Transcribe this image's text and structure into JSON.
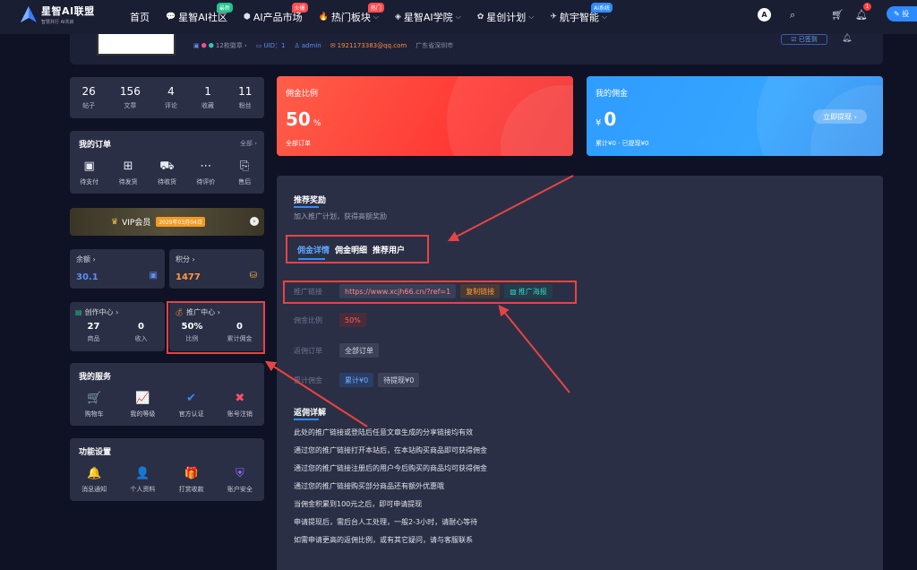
{
  "nav": {
    "logo_title": "星智AI联盟",
    "logo_sub": "智慧共行 AI共启",
    "items": [
      {
        "label": "首页",
        "icon": "",
        "badge": "",
        "badge_color": "",
        "caret": false
      },
      {
        "label": "星智AI社区",
        "icon": "💬",
        "badge": "最新",
        "badge_color": "#1ec48a",
        "caret": false
      },
      {
        "label": "AI产品市场",
        "icon": "⬢",
        "badge": "火爆",
        "badge_color": "#ff4d4f",
        "caret": false
      },
      {
        "label": "热门板块",
        "icon": "🔥",
        "badge": "热门",
        "badge_color": "#ff4d4f",
        "caret": true
      },
      {
        "label": "星智AI学院",
        "icon": "◈",
        "badge": "",
        "badge_color": "",
        "caret": true
      },
      {
        "label": "星创计划",
        "icon": "✿",
        "badge": "",
        "badge_color": "",
        "caret": true
      },
      {
        "label": "航宇智能",
        "icon": "✈",
        "badge": "AI系统",
        "badge_color": "#2e8bff",
        "caret": true
      }
    ],
    "avatar_letter": "A",
    "bell_count": "1",
    "write_label": "✎ 投"
  },
  "profile": {
    "badges": "12枚徽章 ›",
    "uid": "UID：1",
    "username": "admin",
    "email": "1921173383@qq.com",
    "location": "广东省深圳市",
    "checkin": "☑ 已签到"
  },
  "stats": [
    {
      "value": "26",
      "label": "帖子"
    },
    {
      "value": "156",
      "label": "文章"
    },
    {
      "value": "4",
      "label": "评论"
    },
    {
      "value": "1",
      "label": "收藏"
    },
    {
      "value": "11",
      "label": "粉丝"
    }
  ],
  "orders": {
    "title": "我的订单",
    "more": "全部 ›",
    "items": [
      {
        "label": "待支付",
        "icon": "wallet-icon",
        "glyph": "▣"
      },
      {
        "label": "待发货",
        "icon": "package-icon",
        "glyph": "⊞"
      },
      {
        "label": "待收货",
        "icon": "truck-icon",
        "glyph": "⛟"
      },
      {
        "label": "待评价",
        "icon": "comment-icon",
        "glyph": "⋯"
      },
      {
        "label": "售后",
        "icon": "aftersale-icon",
        "glyph": "⎘"
      }
    ]
  },
  "vip": {
    "label": "VIP会员",
    "date": "2029年03月04日"
  },
  "balance": {
    "title": "余额 ›",
    "value": "30.1",
    "color": "#5d8df5"
  },
  "points": {
    "title": "积分 ›",
    "value": "1477",
    "color": "#ff9a3d"
  },
  "creation": {
    "title": "创作中心 ›",
    "cols": [
      {
        "value": "27",
        "label": "商品"
      },
      {
        "value": "0",
        "label": "收入"
      }
    ]
  },
  "promotion": {
    "title": "推广中心 ›",
    "cols": [
      {
        "value": "50%",
        "label": "比例"
      },
      {
        "value": "0",
        "label": "累计佣金"
      }
    ]
  },
  "services": {
    "title": "我的服务",
    "items": [
      {
        "label": "购物车",
        "icon": "cart-icon",
        "glyph": "🛒",
        "color": "#ff7a45"
      },
      {
        "label": "我的等级",
        "icon": "level-icon",
        "glyph": "📈",
        "color": "#6b7cff"
      },
      {
        "label": "官方认证",
        "icon": "verified-icon",
        "glyph": "✔",
        "color": "#2e8bff"
      },
      {
        "label": "账号注销",
        "icon": "user-remove-icon",
        "glyph": "✖",
        "color": "#ff4d6a"
      }
    ]
  },
  "settings": {
    "title": "功能设置",
    "items": [
      {
        "label": "消息通知",
        "icon": "bell-icon",
        "glyph": "🔔",
        "color": "#ff8a3d"
      },
      {
        "label": "个人资料",
        "icon": "profile-icon",
        "glyph": "👤",
        "color": "#5d8df5"
      },
      {
        "label": "打赏收款",
        "icon": "gift-icon",
        "glyph": "🎁",
        "color": "#ff4d8a"
      },
      {
        "label": "账户安全",
        "icon": "shield-icon",
        "glyph": "⛨",
        "color": "#8a6bff"
      }
    ]
  },
  "commission_rate": {
    "title": "佣金比例",
    "value": "50",
    "unit": "%",
    "sub": "全部订单"
  },
  "commission_mine": {
    "title": "我的佣金",
    "currency": "¥",
    "value": "0",
    "sub": "累计¥0 · 已提现¥0",
    "button": "立即提现 ›"
  },
  "referral": {
    "title": "推荐奖励",
    "subtitle": "加入推广计划，获得高额奖励",
    "tabs": [
      "佣金详情",
      "佣金明细",
      "推荐用户"
    ],
    "link_label": "推广链接",
    "link_value": "https://www.xcjh66.cn/?ref=1",
    "copy_button": "复制链接",
    "poster_button": "推广海报",
    "rate_label": "佣金比例",
    "rate_value": "50%",
    "order_label": "返佣订单",
    "order_value": "全部订单",
    "total_label": "累计佣金",
    "total_value": "累计¥0",
    "pending_value": "待提现¥0",
    "rules_title": "返佣详解",
    "rules": [
      "此处的推广链接或登陆后任意文章生成的分享链接均有效",
      "通过您的推广链接打开本站后，在本站购买商品即可获得佣金",
      "通过您的推广链接注册后的用户今后购买的商品均可获得佣金",
      "通过您的推广链接购买部分商品还有额外优惠哦",
      "当佣金积累到100元之后，即可申请提现",
      "申请提现后，需后台人工处理，一般2-3小时，请耐心等待",
      "如需申请更高的返佣比例，或有其它疑问，请与客服联系"
    ]
  }
}
